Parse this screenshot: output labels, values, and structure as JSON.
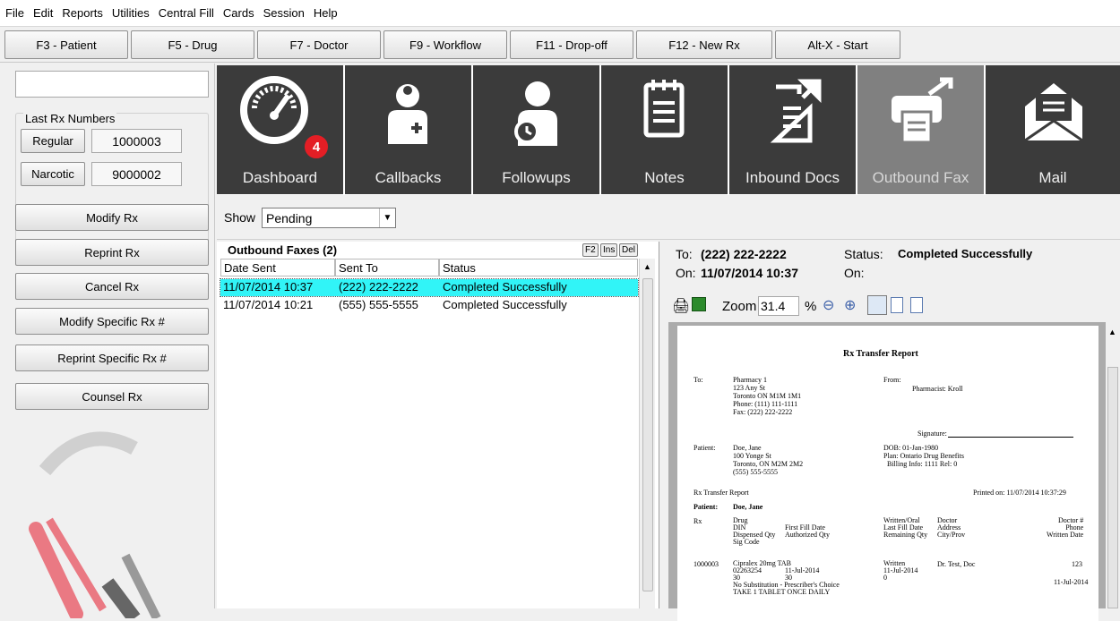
{
  "menu": [
    "File",
    "Edit",
    "Reports",
    "Utilities",
    "Central Fill",
    "Cards",
    "Session",
    "Help"
  ],
  "fkeys": {
    "patient": "F3 - Patient",
    "drug": "F5 - Drug",
    "doctor": "F7 - Doctor",
    "workflow": "F9 - Workflow",
    "dropoff": "F11 - Drop-off",
    "newrx": "F12 - New Rx",
    "start": "Alt-X - Start"
  },
  "last_rx": {
    "title": "Last Rx Numbers",
    "regular_label": "Regular",
    "regular_value": "1000003",
    "narcotic_label": "Narcotic",
    "narcotic_value": "9000002"
  },
  "actions": {
    "modify": "Modify Rx",
    "reprint": "Reprint Rx",
    "cancel": "Cancel Rx",
    "modify_specific": "Modify Specific Rx #",
    "reprint_specific": "Reprint Specific Rx #",
    "counsel": "Counsel Rx"
  },
  "tiles": {
    "dashboard": "Dashboard",
    "dashboard_badge": "4",
    "callbacks": "Callbacks",
    "followups": "Followups",
    "notes": "Notes",
    "inbound": "Inbound Docs",
    "outbound": "Outbound Fax",
    "mail": "Mail"
  },
  "show": {
    "label": "Show",
    "value": "Pending"
  },
  "faxlist": {
    "title": "Outbound Faxes (2)",
    "btn_f2": "F2",
    "btn_ins": "Ins",
    "btn_del": "Del",
    "headers": [
      "Date Sent",
      "Sent To",
      "Status"
    ],
    "rows": [
      [
        "11/07/2014 10:37",
        "(222) 222-2222",
        "Completed Successfully"
      ],
      [
        "11/07/2014 10:21",
        "(555) 555-5555",
        "Completed Successfully"
      ]
    ]
  },
  "detail": {
    "to_label": "To:",
    "to_value": "(222) 222-2222",
    "on_label": "On:",
    "on_value": "11/07/2014 10:37",
    "status_label": "Status:",
    "status_value": "Completed Successfully",
    "on2_label": "On:"
  },
  "viewer": {
    "zoom_label": "Zoom",
    "zoom_value": "31.4",
    "percent": "%"
  },
  "report": {
    "title": "Rx Transfer Report",
    "to_label": "To:",
    "to_lines": "Pharmacy 1\n123 Any St\nToronto ON M1M 1M1\nPhone: (111) 111-1111\nFax: (222) 222-2222",
    "from_label": "From:",
    "from_value": "Pharmacist: Kroll",
    "signature": "Signature:",
    "patient_label": "Patient:",
    "patient_lines": "Doe, Jane\n100 Yonge St\nToronto, ON M2M 2M2\n(555) 555-5555",
    "patient_info": "DOB: 01-Jan-1980\nPlan: Ontario Drug Benefits\n  Billing Info: 1111 Rel: 0",
    "subtitle": "Rx Transfer Report",
    "printed": "Printed on: 11/07/2014 10:37:29",
    "patient_bold_label": "Patient:",
    "patient_bold": "Doe, Jane",
    "col_rx": "Rx",
    "col_drug": "Drug\nDIN\nDispensed Qty\nSig Code",
    "col_fill": "First Fill Date\nAuthorized Qty",
    "col_written": "Written/Oral\nLast Fill Date\nRemaining Qty",
    "col_doctor": "Doctor\nAddress\nCity/Prov",
    "col_docnum": "Doctor #\nPhone\nWritten Date",
    "row_rx": "1000003",
    "row_drug": "Cipralex 20mg TAB\n02263254\n30\nNo Substitution - Prescriber's Choice\nTAKE 1 TABLET ONCE DAILY",
    "row_fill": "11-Jul-2014\n30",
    "row_written": "Written\n11-Jul-2014\n0",
    "row_doctor": "Dr. Test, Doc",
    "row_docnum": "123",
    "row_date": "11-Jul-2014"
  }
}
